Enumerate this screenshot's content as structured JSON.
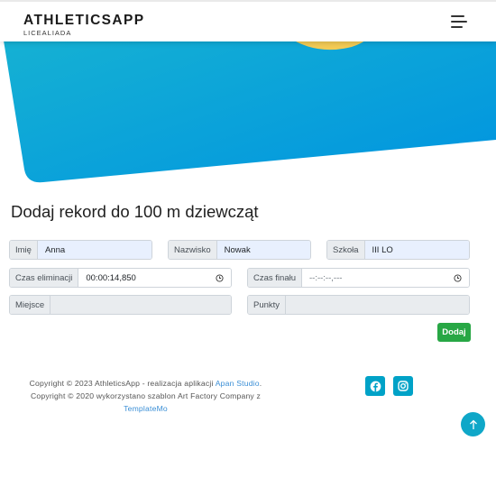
{
  "header": {
    "logo_title": "ATHLETICSAPP",
    "logo_subtitle": "LICEALIADA"
  },
  "page_title": "Dodaj rekord do 100 m dziewcząt",
  "form": {
    "first_name": {
      "label": "Imię",
      "value": "Anna"
    },
    "last_name": {
      "label": "Nazwisko",
      "value": "Nowak"
    },
    "school": {
      "label": "Szkoła",
      "value": "III LO"
    },
    "elimination_time": {
      "label": "Czas eliminacji",
      "value": "00:00:14,850"
    },
    "final_time": {
      "label": "Czas finału",
      "value": "--:--:--,---"
    },
    "place": {
      "label": "Miejsce",
      "value": ""
    },
    "points": {
      "label": "Punkty",
      "value": ""
    },
    "submit_label": "Dodaj"
  },
  "footer": {
    "line1_prefix": "Copyright © 2023 AthleticsApp - realizacja aplikacji ",
    "line1_link": "Apan Studio",
    "line1_suffix": ".",
    "line2": "Copyright © 2020 wykorzystano szablon Art Factory Company z",
    "line3_link": "TemplateMo"
  },
  "icons": {
    "menu": "hamburger-icon",
    "clock": "clock-icon",
    "facebook": "facebook-icon",
    "instagram": "instagram-icon",
    "scroll_top": "arrow-up-icon"
  },
  "colors": {
    "banner_blue": "#0aa8d8",
    "banner_yellow": "#f2c94c",
    "submit_green": "#28a745",
    "social_teal": "#00a2c7",
    "autofill_blue": "#e8f0fe"
  }
}
